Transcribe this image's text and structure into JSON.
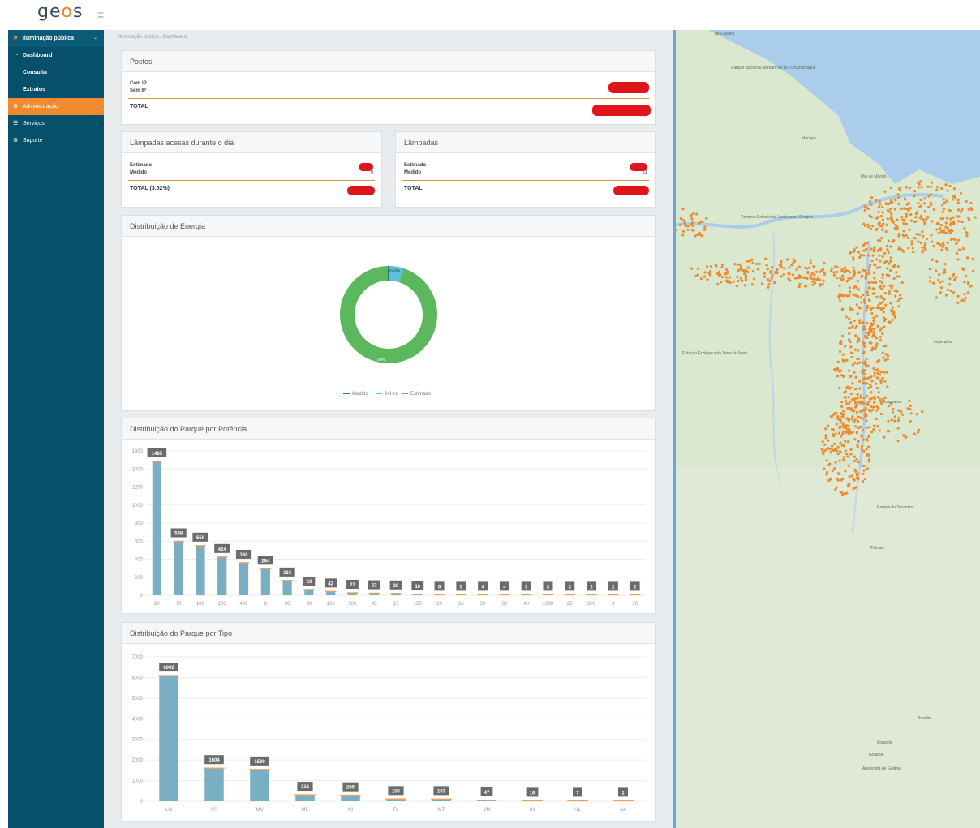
{
  "app": {
    "logo_left": "ge",
    "logo_o": "o",
    "logo_right": "s",
    "menu_icon": "hamburger-icon"
  },
  "sidebar": {
    "items": [
      {
        "label": "Iluminação pública",
        "icon": "flag-icon"
      },
      {
        "label": "Dashboard"
      },
      {
        "label": "Consulta"
      },
      {
        "label": "Extratos"
      },
      {
        "label": "Administração",
        "icon": "gear-icon"
      },
      {
        "label": "Serviços",
        "icon": "list-icon"
      },
      {
        "label": "Suporte",
        "icon": "support-icon"
      }
    ]
  },
  "breadcrumb": {
    "root": "Iluminação pública",
    "sep": "/",
    "current": "Dashboard"
  },
  "postes": {
    "title": "Postes",
    "rows": [
      {
        "label": "Com IP"
      },
      {
        "label": "Sem IP"
      }
    ],
    "total_label": "TOTAL"
  },
  "acesas": {
    "title": "Lâmpadas acesas durante o dia",
    "rows": [
      {
        "label": "Estimado",
        "value": ""
      },
      {
        "label": "Medido",
        "value": "0"
      }
    ],
    "total_label": "TOTAL (3.52%)"
  },
  "lampadas": {
    "title": "Lâmpadas",
    "rows": [
      {
        "label": "Estimado",
        "value": ""
      },
      {
        "label": "Medido",
        "value": "51"
      }
    ],
    "total_label": "TOTAL"
  },
  "energia": {
    "title": "Distribuição de Energia",
    "legend": [
      "Medido",
      "24Hrs",
      "Estimado"
    ],
    "labels": {
      "small": "1%0%",
      "big": "99%"
    }
  },
  "colors": {
    "sidebar": "#07506b",
    "accent": "#ef8a2e",
    "bar": "#7aaec3",
    "donut": "#5cb85c",
    "donut_small": "#5bc0de",
    "label_bg": "#6b6b6b",
    "redaction": "#e0151b"
  },
  "chart_data": [
    {
      "type": "pie",
      "title": "Distribuição de Energia",
      "categories": [
        "Medido",
        "24Hrs",
        "Estimado"
      ],
      "values": [
        1,
        0,
        99
      ]
    },
    {
      "type": "bar",
      "title": "Distribuição do Parque por Potência",
      "categories": [
        "60",
        "70",
        "100",
        "200",
        "400",
        "0",
        "90",
        "30",
        "160",
        "500",
        "45",
        "15",
        "125",
        "20",
        "36",
        "50",
        "80",
        "40",
        "1000",
        "25",
        "300",
        "9",
        "10"
      ],
      "values": [
        1485,
        598,
        550,
        424,
        360,
        294,
        163,
        63,
        42,
        27,
        22,
        20,
        10,
        6,
        5,
        4,
        4,
        3,
        3,
        2,
        2,
        2,
        2
      ],
      "yticks": [
        0,
        200,
        400,
        600,
        800,
        1000,
        1200,
        1400,
        1600
      ],
      "ylim": [
        0,
        1600
      ]
    },
    {
      "type": "bar",
      "title": "Distribuição do Parque por Tipo",
      "categories": [
        "LO",
        "VS",
        "MV",
        "ME",
        "NI",
        "FL",
        "MT",
        "VM",
        "IN",
        "HL",
        "AA"
      ],
      "values": [
        6092,
        1604,
        1539,
        312,
        289,
        106,
        103,
        47,
        16,
        7,
        1
      ],
      "yticks": [
        0,
        1000,
        2000,
        3000,
        4000,
        5000,
        6000,
        7000
      ],
      "ylim": [
        0,
        7000
      ]
    }
  ],
  "map": {
    "labels": [
      "de Guyane",
      "Parque Nacional Montanhas do Tumucumaque",
      "Macapá",
      "Ilha de Marajó",
      "Reserva Extrativista Verde para Sempre",
      "Estação Ecológica da Terra do Meio",
      "Imperatriz",
      "Araguaína",
      "Parque do Tocantins",
      "Palmas",
      "Brasília",
      "Goiânia",
      "Aparecida de Goiânia",
      "Anápolis"
    ]
  }
}
